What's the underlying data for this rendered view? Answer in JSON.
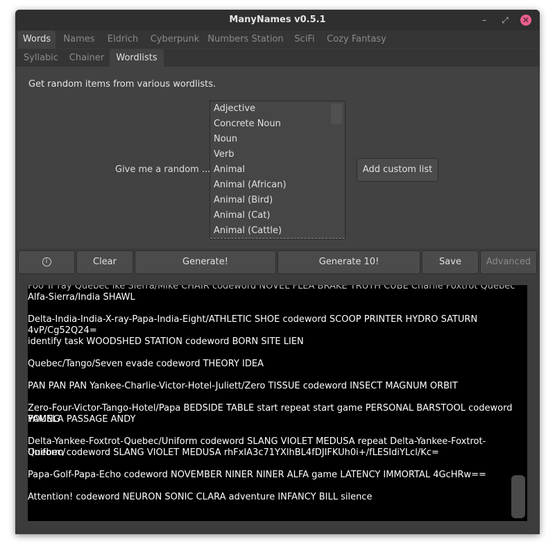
{
  "window": {
    "title": "ManyNames v0.5.1"
  },
  "tabs_row1": [
    "Words",
    "Names",
    "Eldrich",
    "Cyberpunk",
    "Numbers Station",
    "SciFi",
    "Cozy Fantasy"
  ],
  "tabs_row2": [
    "Syllabic",
    "Chainer",
    "Wordlists"
  ],
  "panel": {
    "description": "Get random items from various wordlists.",
    "prompt": "Give me a random ...",
    "add_custom": "Add custom list"
  },
  "wordlists": [
    "Adjective",
    "Concrete Noun",
    "Noun",
    "Verb",
    "Animal",
    "Animal (African)",
    "Animal (Bird)",
    "Animal (Cat)",
    "Animal (Cattle)"
  ],
  "toolbar": {
    "info_icon": "info-icon",
    "clear": "Clear",
    "generate": "Generate!",
    "generate10": "Generate 10!",
    "save": "Save",
    "advanced": "Advanced"
  },
  "output": [
    "Foo Tr ray Quebec ike Sierra/Mike CHAIR codeword NOVEL FLEA BRAKE TRUTH CUBE Charlie Foxtrot Quebec",
    "Alfa-Sierra/India SHAWL",
    "Delta-India-India-X-ray-Papa-India-Eight/ATHLETIC SHOE codeword SCOOP PRINTER HYDRO SATURN 4vP/Cg52Q24=",
    "identify task WOODSHED STATION codeword BORN SITE LIEN",
    "Quebec/Tango/Seven evade codeword THEORY IDEA",
    "PAN PAN PAN Yankee-Charlie-Victor-Hotel-Juliett/Zero TISSUE codeword INSECT MAGNUM ORBIT",
    "Zero-Four-Victor-Tango-Hotel/Papa BEDSIDE TABLE start repeat start game PERSONAL BARSTOOL codeword YOUNG",
    "PAMELA PASSAGE ANDY",
    "Delta-Yankee-Foxtrot-Quebec/Uniform codeword SLANG VIOLET MEDUSA repeat Delta-Yankee-Foxtrot-Quebec/",
    "Uniform codeword SLANG VIOLET MEDUSA rhFxIA3c71YXlhBL4fDJIFKUh0i+/fLESIdiYLcl/Kc=",
    "Papa-Golf-Papa-Echo codeword NOVEMBER NINER NINER ALFA game LATENCY IMMORTAL 4GcHRw==",
    "Attention! codeword NEURON SONIC CLARA adventure INFANCY BILL silence"
  ]
}
